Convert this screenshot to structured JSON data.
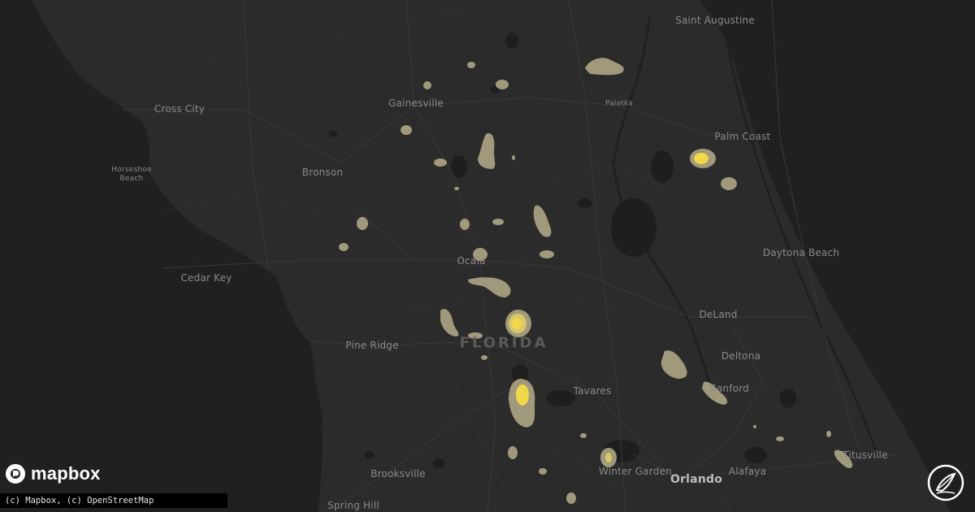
{
  "map": {
    "state_label": "FLORIDA",
    "cities": [
      {
        "name": "Saint Augustine",
        "tier": "normal"
      },
      {
        "name": "Gainesville",
        "tier": "normal"
      },
      {
        "name": "Palatka",
        "tier": "small"
      },
      {
        "name": "Cross City",
        "tier": "normal"
      },
      {
        "name": "Palm Coast",
        "tier": "normal"
      },
      {
        "name": "Horseshoe\nBeach",
        "tier": "small"
      },
      {
        "name": "Bronson",
        "tier": "normal"
      },
      {
        "name": "Daytona Beach",
        "tier": "normal"
      },
      {
        "name": "Cedar Key",
        "tier": "normal"
      },
      {
        "name": "Ocala",
        "tier": "normal"
      },
      {
        "name": "DeLand",
        "tier": "normal"
      },
      {
        "name": "Pine Ridge",
        "tier": "normal"
      },
      {
        "name": "Deltona",
        "tier": "normal"
      },
      {
        "name": "Tavares",
        "tier": "normal"
      },
      {
        "name": "Sanford",
        "tier": "normal"
      },
      {
        "name": "Titusville",
        "tier": "normal"
      },
      {
        "name": "Winter Garden",
        "tier": "normal"
      },
      {
        "name": "Orlando",
        "tier": "big"
      },
      {
        "name": "Alafaya",
        "tier": "normal"
      },
      {
        "name": "Brooksville",
        "tier": "normal"
      },
      {
        "name": "Spring Hill",
        "tier": "normal"
      }
    ],
    "colors": {
      "land": "#2b2b2b",
      "water": "#202020",
      "road": "#363636",
      "hail_light": "#b5ad8a",
      "hail_medium": "#d9c86a",
      "hail_heavy": "#f0d84a"
    }
  },
  "branding": {
    "logo_text": "mapbox",
    "attribution": "(c) Mapbox, (c) OpenStreetMap",
    "logo_icon": "mapbox-logo-icon",
    "badge_icon": "feather-circle-icon"
  }
}
